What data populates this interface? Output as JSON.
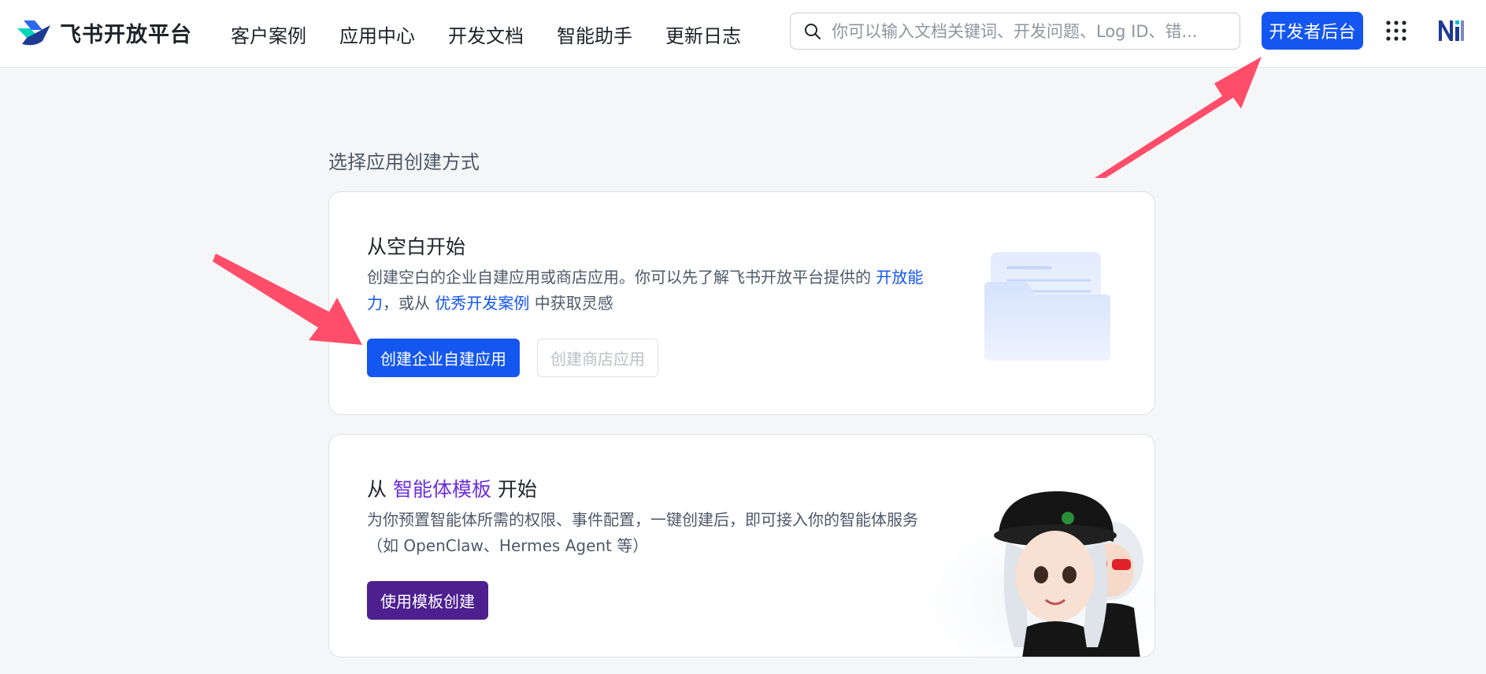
{
  "header": {
    "logo_text": "飞书开放平台",
    "nav": [
      {
        "label": "客户案例"
      },
      {
        "label": "应用中心"
      },
      {
        "label": "开发文档"
      },
      {
        "label": "智能助手"
      },
      {
        "label": "更新日志"
      }
    ],
    "search_placeholder": "你可以输入文档关键词、开发问题、Log ID、错...",
    "developer_button": "开发者后台"
  },
  "main": {
    "section_title": "选择应用创建方式",
    "blank_card": {
      "title": "从空白开始",
      "desc_part1": "创建空白的企业自建应用或商店应用。你可以先了解飞书开放平台提供的 ",
      "desc_link1": "开放能力",
      "desc_part2": "，或从 ",
      "desc_link2": "优秀开发案例",
      "desc_part3": " 中获取灵感",
      "primary_button": "创建企业自建应用",
      "secondary_button": "创建商店应用"
    },
    "template_card": {
      "title_prefix": "从 ",
      "title_highlight": "智能体模板",
      "title_suffix": " 开始",
      "desc": "为你预置智能体所需的权限、事件配置，一键创建后，即可接入你的智能体服务（如 OpenClaw、Hermes Agent 等）",
      "button": "使用模板创建"
    }
  },
  "colors": {
    "primary": "#1456f0",
    "purple_button": "#4d1f8f",
    "highlight_purple": "#6b2fd9",
    "annotation_arrow": "#ff4d6a"
  }
}
